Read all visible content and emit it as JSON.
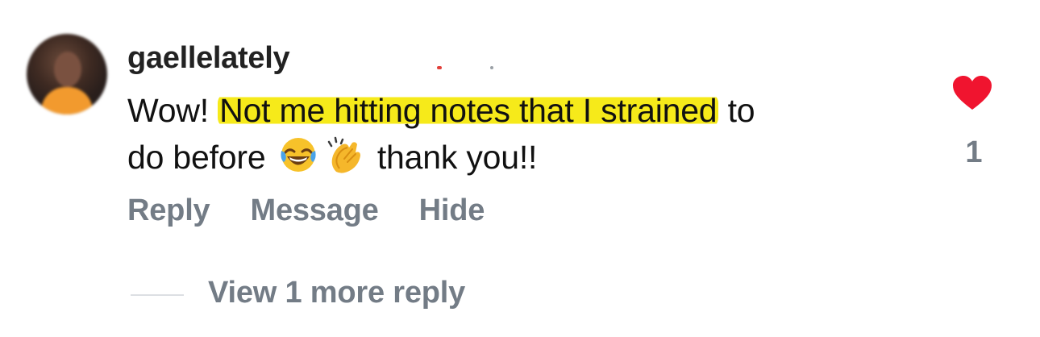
{
  "comment": {
    "username": "gaellelately",
    "text_before": "Wow! ",
    "text_highlighted": "Not me hitting notes that I strained",
    "text_after_1": " to",
    "text_after_2": "do before",
    "text_after_3": " thank you!!",
    "emojis": [
      "face-with-tears-of-joy-icon",
      "clapping-hands-icon"
    ]
  },
  "actions": {
    "reply": "Reply",
    "message": "Message",
    "hide": "Hide"
  },
  "like": {
    "count": "1",
    "liked": true,
    "color": "#f0142f"
  },
  "replies": {
    "view_more": "View 1 more reply"
  },
  "colors": {
    "highlight": "#f6ea1a",
    "secondary_text": "#737c86"
  }
}
